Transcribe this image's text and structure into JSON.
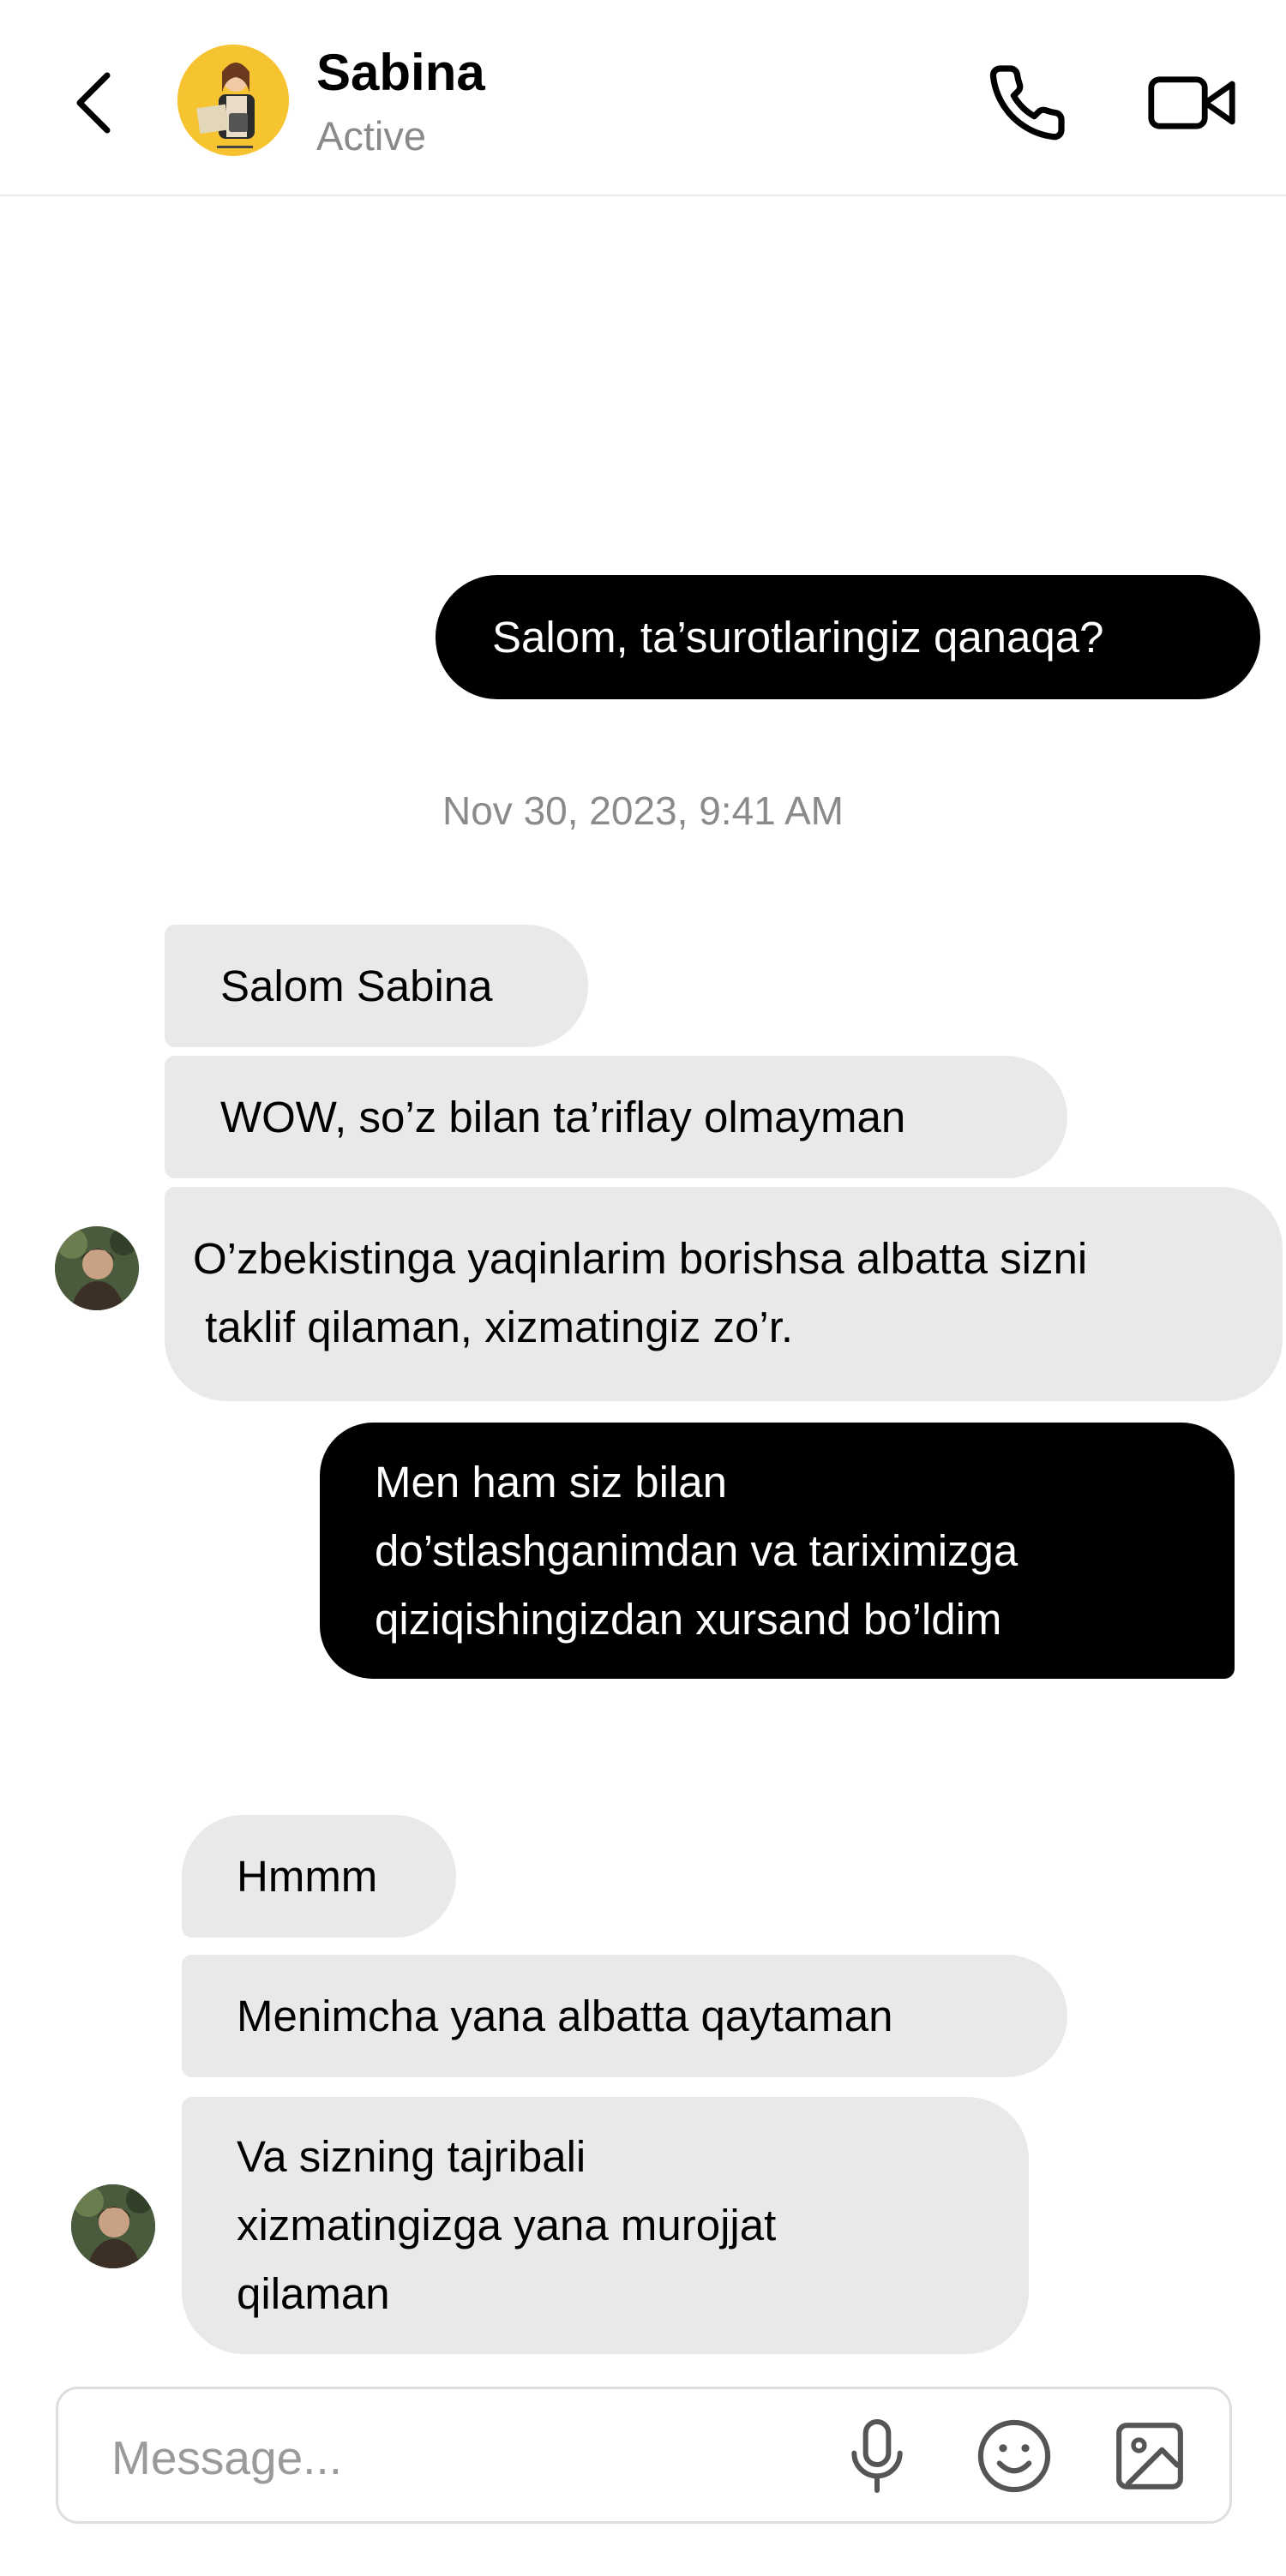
{
  "header": {
    "contact_name": "Sabina",
    "status": "Active",
    "back_icon": "chevron-left-icon",
    "call_icon": "phone-icon",
    "video_icon": "video-camera-icon"
  },
  "messages": [
    {
      "direction": "outgoing",
      "text": "Salom, ta’surotlaringiz qanaqa?"
    },
    {
      "direction": "incoming",
      "text": "Salom Sabina"
    },
    {
      "direction": "incoming",
      "text": "WOW, so’z bilan ta’riflay olmayman"
    },
    {
      "direction": "incoming",
      "lines": [
        "O’zbekistinga yaqinlarim borishsa albatta sizni",
        " taklif qilaman, xizmatingiz zo’r."
      ]
    },
    {
      "direction": "outgoing",
      "lines": [
        "Men ham siz bilan",
        "do’stlashganimdan va tariximizga",
        "qiziqishingizdan xursand bo’ldim"
      ]
    },
    {
      "direction": "incoming",
      "text": "Hmmm"
    },
    {
      "direction": "incoming",
      "text": "Menimcha yana albatta qaytaman"
    },
    {
      "direction": "incoming",
      "lines": [
        "Va sizning tajribali",
        "xizmatingizga yana murojjat",
        "qilaman"
      ]
    }
  ],
  "timestamp": "Nov 30, 2023, 9:41 AM",
  "composer": {
    "placeholder": "Message...",
    "value": "",
    "mic_icon": "microphone-icon",
    "emoji_icon": "smiley-icon",
    "image_icon": "image-icon"
  },
  "colors": {
    "outgoing_bubble": "#000000",
    "incoming_bubble": "#e9e9eb",
    "muted_text": "#8a8a8a",
    "header_avatar_bg": "#f7c431"
  }
}
